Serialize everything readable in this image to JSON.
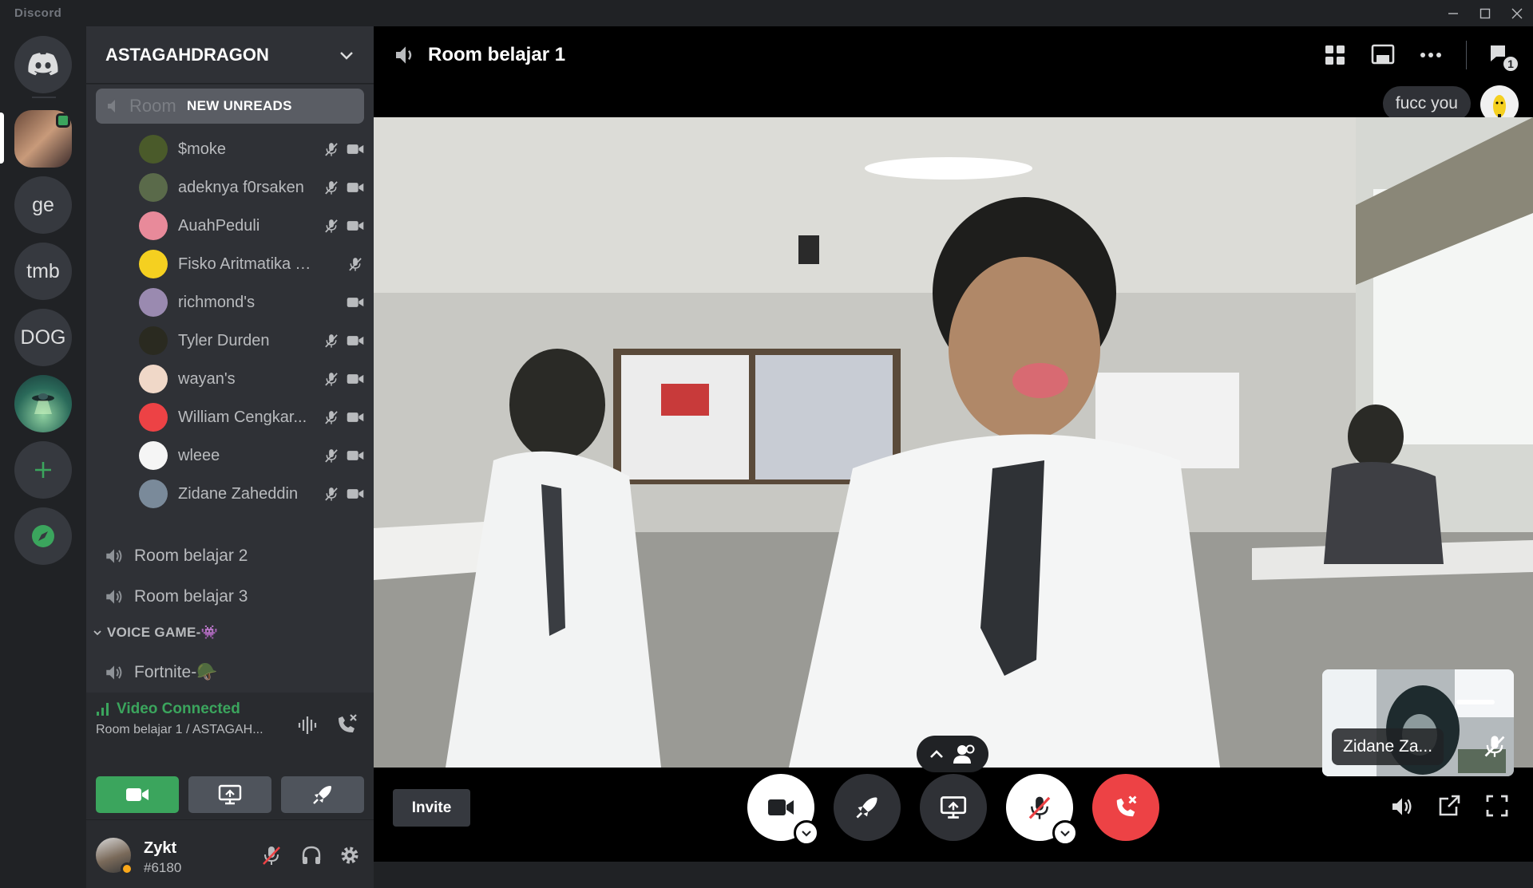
{
  "app": {
    "title": "Discord"
  },
  "servers": [
    {
      "name": "home",
      "label": ""
    },
    {
      "name": "astagahdragon",
      "label": ""
    },
    {
      "name": "ge",
      "label": "ge"
    },
    {
      "name": "tmb",
      "label": "tmb"
    },
    {
      "name": "dog",
      "label": "DOG"
    },
    {
      "name": "ufo",
      "label": ""
    }
  ],
  "sidebar": {
    "guild_name": "ASTAGAHDRAGON",
    "unreads_ghost": "Room",
    "unreads_label": "NEW UNREADS",
    "voice_users": [
      {
        "name": "$moke",
        "muted": true,
        "camera": true,
        "avatar_color": "#4a5a2a"
      },
      {
        "name": "adeknya f0rsaken",
        "muted": true,
        "camera": true,
        "avatar_color": "#5a6a4a"
      },
      {
        "name": "AuahPeduli",
        "muted": true,
        "camera": true,
        "avatar_color": "#e88a9a"
      },
      {
        "name": "Fisko Aritmatika Yuri",
        "muted": true,
        "camera": false,
        "avatar_color": "#f5d020"
      },
      {
        "name": "richmond's",
        "muted": false,
        "camera": true,
        "avatar_color": "#9a8ab0"
      },
      {
        "name": "Tyler Durden",
        "muted": true,
        "camera": true,
        "avatar_color": "#2a2a20"
      },
      {
        "name": "wayan's",
        "muted": true,
        "camera": true,
        "avatar_color": "#f0d8c8"
      },
      {
        "name": "William Cengkar...",
        "muted": true,
        "camera": true,
        "avatar_color": "#ed4245"
      },
      {
        "name": "wleee",
        "muted": true,
        "camera": true,
        "avatar_color": "#f5f5f5"
      },
      {
        "name": "Zidane Zaheddin",
        "muted": true,
        "camera": true,
        "avatar_color": "#7a8a9a"
      }
    ],
    "channels": [
      {
        "name": "Room belajar 2"
      },
      {
        "name": "Room belajar 3"
      }
    ],
    "category": "VOICE GAME-👾",
    "category_channel": "Fortnite-🪖"
  },
  "voice_panel": {
    "status": "Video Connected",
    "location": "Room belajar 1 / ASTAGAH..."
  },
  "user_panel": {
    "username": "Zykt",
    "tag": "#6180"
  },
  "main": {
    "channel_title": "Room belajar 1",
    "inbox_badge": "1",
    "chat_message": "fucc you",
    "pip_name": "Zidane Za...",
    "invite_label": "Invite"
  },
  "colors": {
    "green": "#3ba55d",
    "red": "#ed4245",
    "sidebar": "#2f3136",
    "rail": "#202225"
  }
}
